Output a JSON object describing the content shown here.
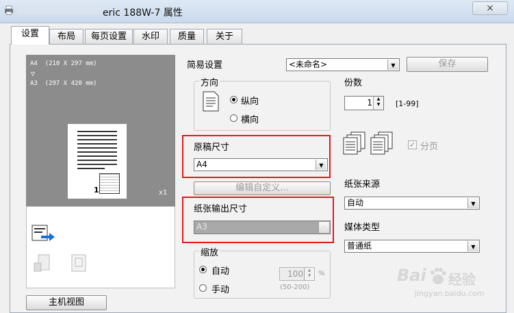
{
  "window": {
    "title": "eric 188W-7 属性",
    "close": "×"
  },
  "tabs": [
    {
      "label": "设置",
      "active": true
    },
    {
      "label": "布局"
    },
    {
      "label": "每页设置"
    },
    {
      "label": "水印"
    },
    {
      "label": "质量"
    },
    {
      "label": "关于"
    }
  ],
  "preview": {
    "line1": "A4  (210 X 297 mm)",
    "arrow": "▽",
    "line2": "A3  (297 X 420 mm)",
    "copies": "x1",
    "page_num": "1"
  },
  "host_view_button": "主机视图",
  "easy_setting": {
    "label": "简易设置",
    "value": "<未命名>",
    "save": "保存"
  },
  "orientation": {
    "title": "方向",
    "portrait": "纵向",
    "landscape": "横向",
    "selected": "portrait"
  },
  "copies": {
    "label": "份数",
    "value": "1",
    "range": "[1-99]"
  },
  "collate": {
    "label": "分页",
    "checked": true
  },
  "original_size": {
    "label": "原稿尺寸",
    "value": "A4"
  },
  "edit_custom": "编辑自定义...",
  "output_size": {
    "label": "纸张输出尺寸",
    "value": "A3"
  },
  "paper_source": {
    "label": "纸张来源",
    "value": "自动"
  },
  "media_type": {
    "label": "媒体类型",
    "value": "普通纸"
  },
  "zoom": {
    "title": "缩放",
    "auto": "自动",
    "manual": "手动",
    "value": "100",
    "unit": "%",
    "range": "(50-200)",
    "selected": "auto"
  },
  "watermark": {
    "brand": "Bai",
    "brand2": "经验",
    "url": "jingyan.baidu.com"
  }
}
